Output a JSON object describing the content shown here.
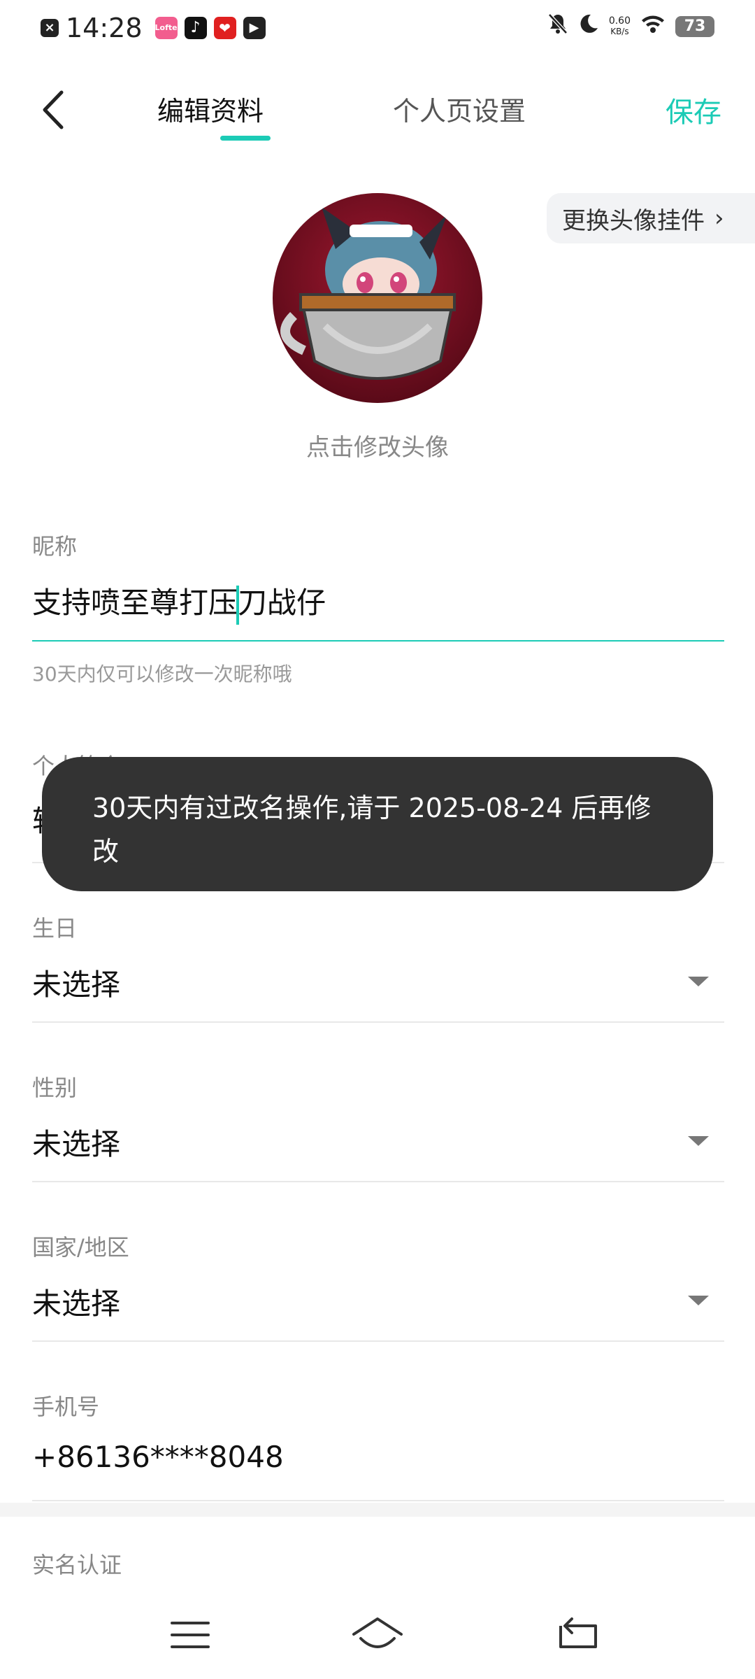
{
  "status_bar": {
    "time": "14:28",
    "network_speed": "0.60",
    "network_unit": "KB/s",
    "battery": "73",
    "apps": [
      {
        "name": "lofter-app-icon",
        "label": "Lofter",
        "color": "#f25d8e"
      },
      {
        "name": "tiktok-app-icon",
        "label": "♪",
        "color": "#111111"
      },
      {
        "name": "heart-app-icon",
        "label": "❤",
        "color": "#e02020"
      },
      {
        "name": "video-app-icon",
        "label": "▶",
        "color": "#222222"
      }
    ]
  },
  "header": {
    "tab_edit": "编辑资料",
    "tab_profile": "个人页设置",
    "save": "保存"
  },
  "avatar": {
    "pendant_button": "更换头像挂件",
    "hint": "点击修改头像"
  },
  "form": {
    "nickname": {
      "label": "昵称",
      "value_before_caret": "支持喷至尊打压",
      "value_after_caret": "刀战仔",
      "helper": "30天内仅可以修改一次昵称哦"
    },
    "bio": {
      "label": "个人简介",
      "value": "轻"
    },
    "birthday": {
      "label": "生日",
      "value": "未选择"
    },
    "gender": {
      "label": "性别",
      "value": "未选择"
    },
    "region": {
      "label": "国家/地区",
      "value": "未选择"
    },
    "phone": {
      "label": "手机号",
      "value": "+86136****8048"
    },
    "verification": {
      "label": "实名认证"
    }
  },
  "toast": {
    "message": "30天内有过改名操作,请于 2025-08-24 后再修改"
  },
  "colors": {
    "accent": "#1ccbb6",
    "toast_bg": "#333333"
  }
}
